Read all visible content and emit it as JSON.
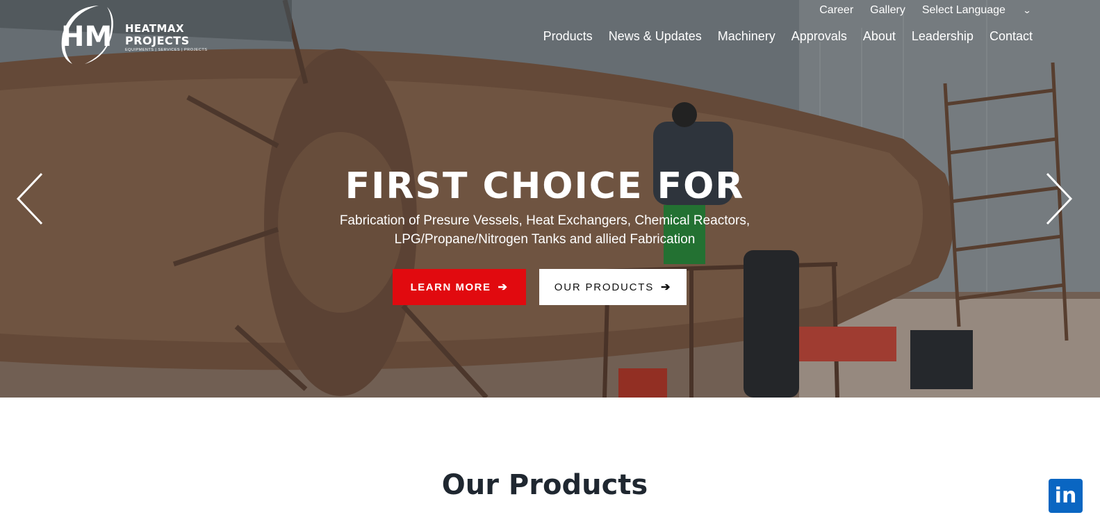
{
  "header": {
    "logo": {
      "line1": "HEATMAX",
      "line2": "PROJECTS",
      "tagline": "EQUIPMENTS | SERVICES | PROJECTS",
      "monogram": "HM"
    },
    "utility_nav": [
      {
        "label": "Career"
      },
      {
        "label": "Gallery"
      }
    ],
    "language_select": {
      "value": "Select Language",
      "icon": "chevron-down-icon"
    },
    "main_nav": [
      {
        "label": "Products"
      },
      {
        "label": "News & Updates"
      },
      {
        "label": "Machinery"
      },
      {
        "label": "Approvals"
      },
      {
        "label": "About"
      },
      {
        "label": "Leadership"
      },
      {
        "label": "Contact"
      }
    ]
  },
  "hero": {
    "headline": "FIRST CHOICE FOR",
    "subline_1": "Fabrication of Presure Vessels, Heat Exchangers, Chemical Reactors,",
    "subline_2": "LPG/Propane/Nitrogen Tanks and allied Fabrication",
    "buttons": {
      "learn_more": "LEARN MORE",
      "our_products": "OUR PRODUCTS"
    },
    "arrow_glyph": "➔",
    "prev_icon": "chevron-left-icon",
    "next_icon": "chevron-right-icon"
  },
  "products_section": {
    "title": "Our Products"
  },
  "social": {
    "linkedin_label": "in"
  },
  "colors": {
    "accent_red": "#e10a0f",
    "linkedin_blue": "#0a66c2",
    "heading_dark": "#1f2730"
  }
}
